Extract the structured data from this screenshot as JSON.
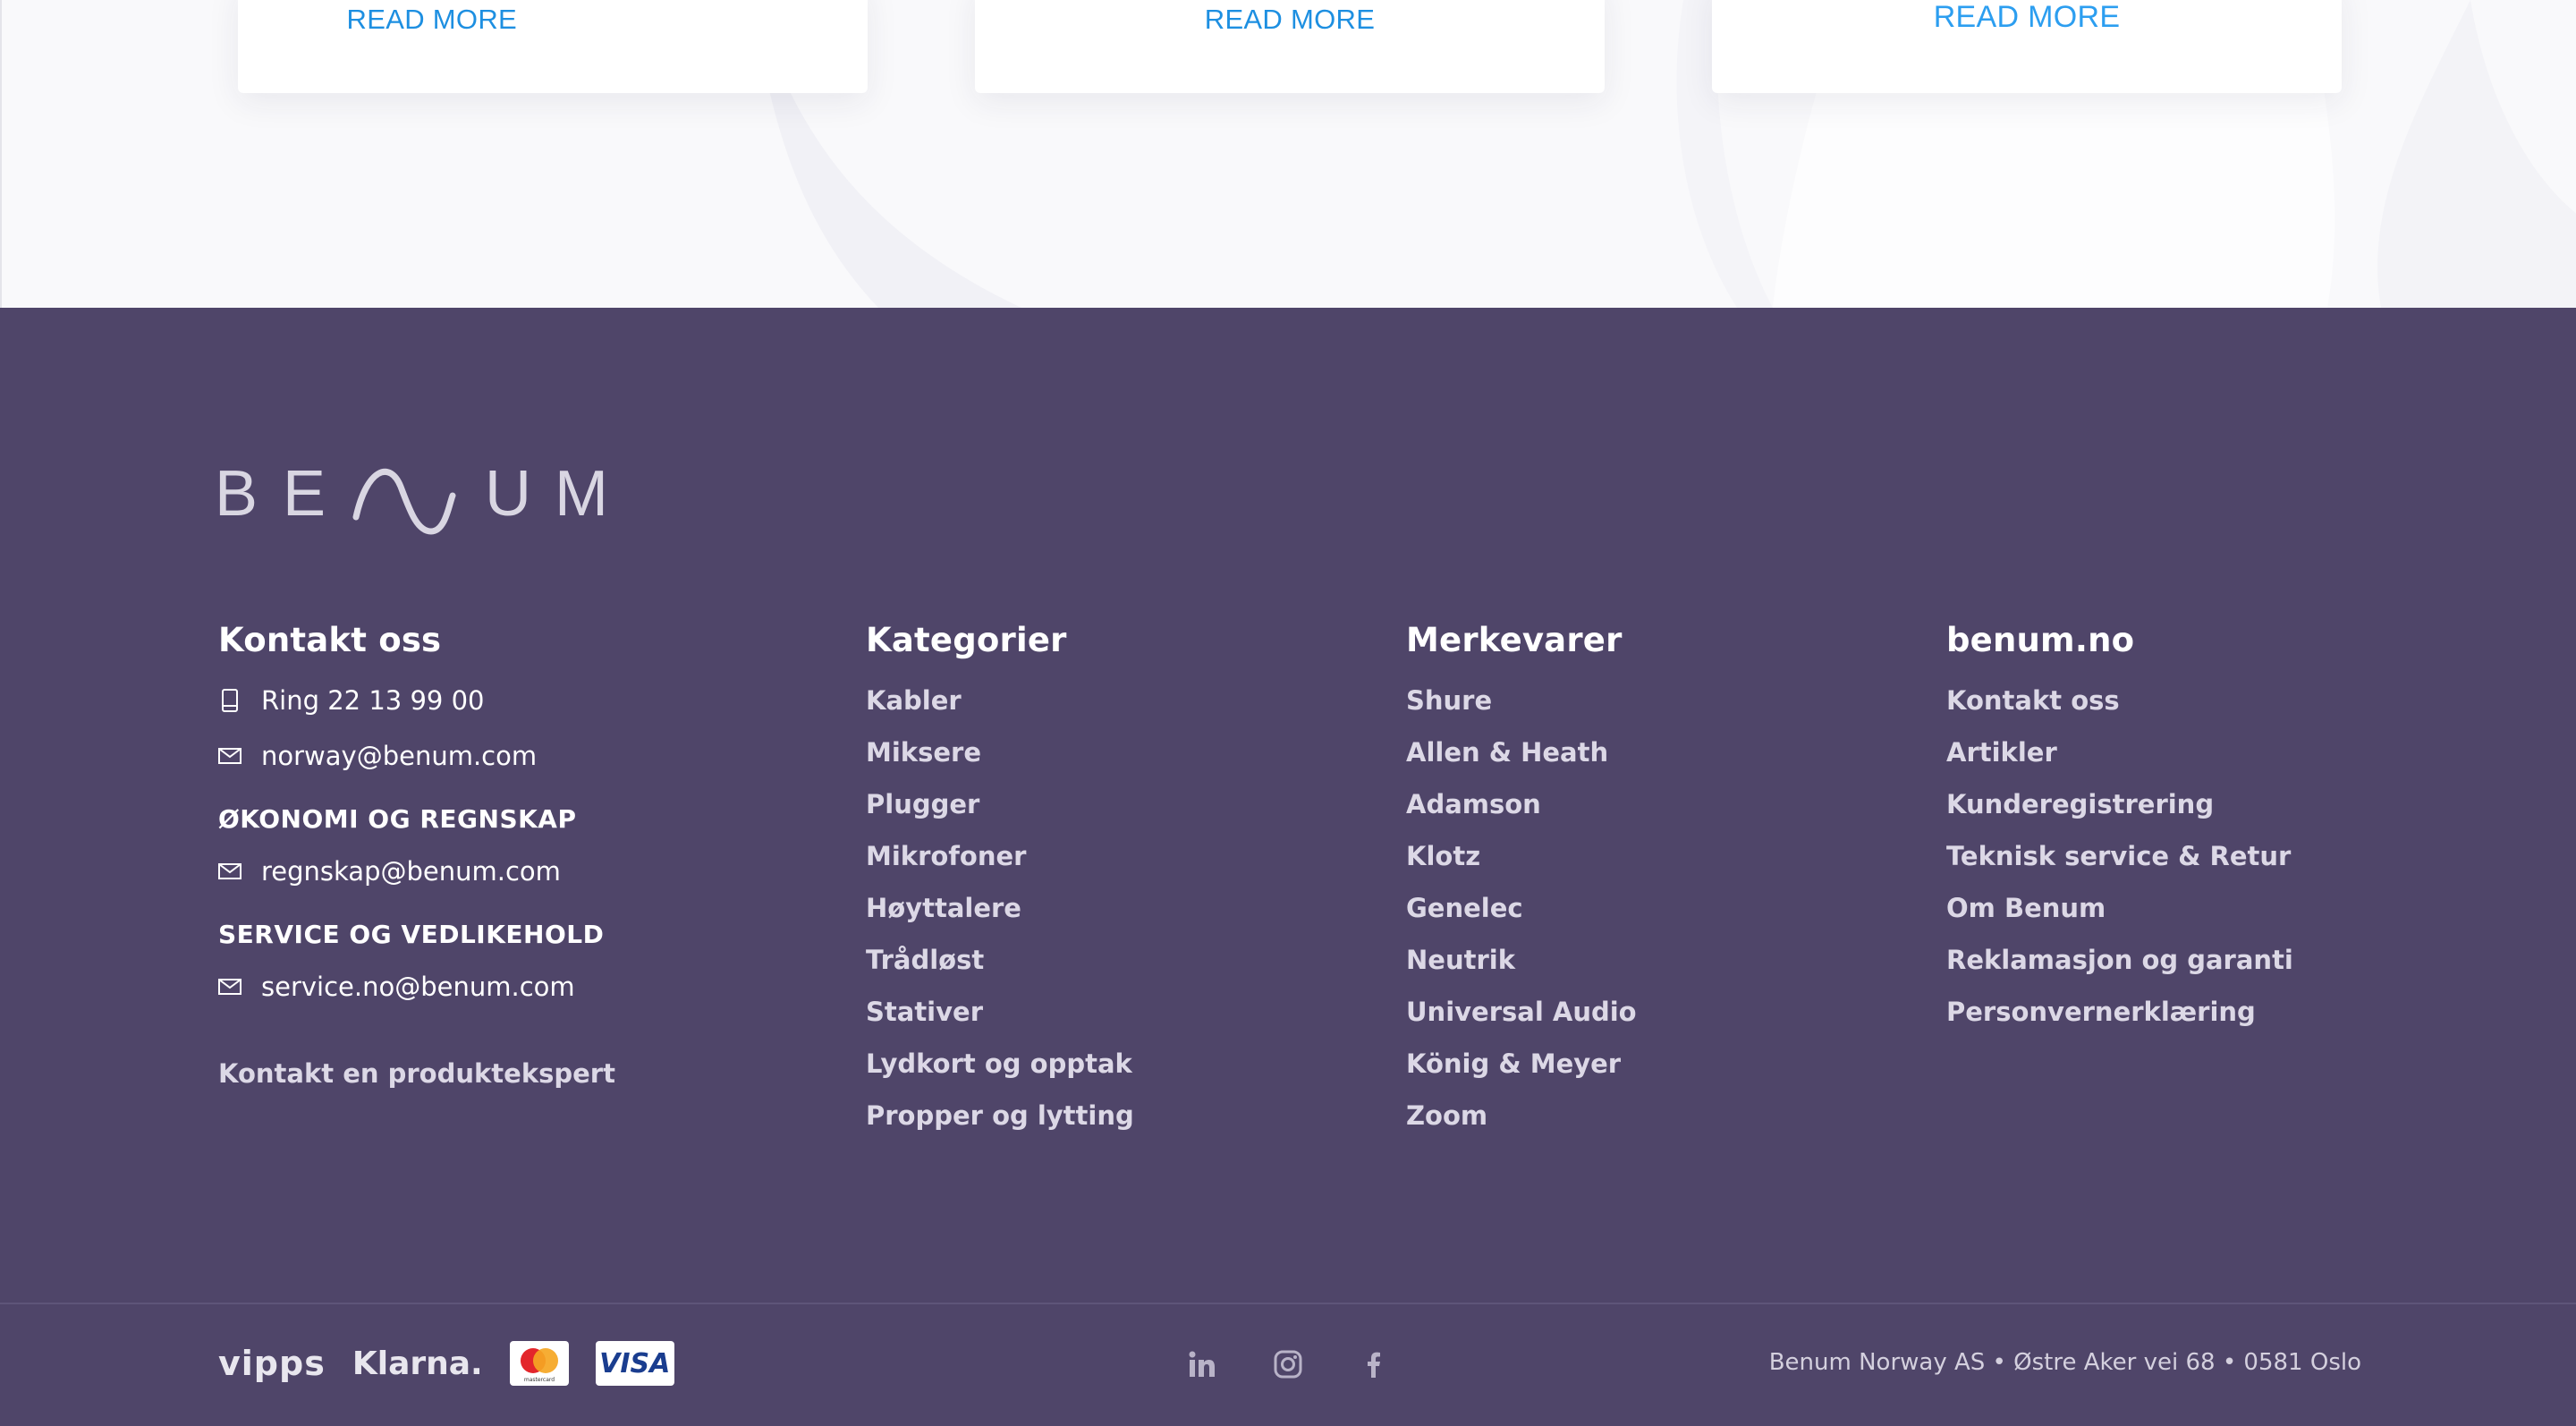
{
  "cards": {
    "read_more_1": "READ MORE",
    "read_more_2": "READ MORE",
    "read_more_3": "READ MORE"
  },
  "footer": {
    "logo_text": "BENUM",
    "contact": {
      "title": "Kontakt oss",
      "phone": "Ring 22 13 99 00",
      "email": "norway@benum.com",
      "finance_title": "ØKONOMI OG REGNSKAP",
      "finance_email": "regnskap@benum.com",
      "service_title": "SERVICE OG VEDLIKEHOLD",
      "service_email": "service.no@benum.com",
      "expert_link": "Kontakt en produktekspert"
    },
    "categories": {
      "title": "Kategorier",
      "items": [
        "Kabler",
        "Miksere",
        "Plugger",
        "Mikrofoner",
        "Høyttalere",
        "Trådløst",
        "Stativer",
        "Lydkort og opptak",
        "Propper og lytting"
      ]
    },
    "brands": {
      "title": "Merkevarer",
      "items": [
        "Shure",
        "Allen & Heath",
        "Adamson",
        "Klotz",
        "Genelec",
        "Neutrik",
        "Universal Audio",
        "König & Meyer",
        "Zoom"
      ]
    },
    "site": {
      "title": "benum.no",
      "items": [
        "Kontakt oss",
        "Artikler",
        "Kunderegistrering",
        "Teknisk service & Retur",
        "Om Benum",
        "Reklamasjon og garanti",
        "Personvernerklæring"
      ]
    },
    "payment": {
      "vipps": "vipps",
      "klarna": "Klarna.",
      "mastercard": "mastercard",
      "visa": "VISA"
    },
    "social_icons": [
      "linkedin-icon",
      "instagram-icon",
      "facebook-icon"
    ],
    "address": "Benum Norway AS • Østre Aker vei 68 • 0581 Oslo"
  },
  "colors": {
    "footer_bg": "#4f4569",
    "link_blue": "#1d8fe1",
    "top_bg": "#f9f9fb"
  }
}
